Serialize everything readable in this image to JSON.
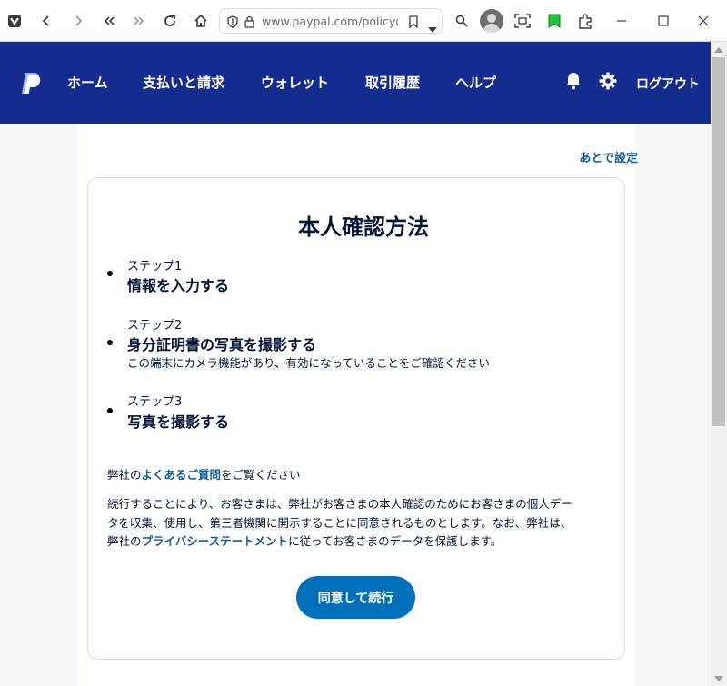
{
  "browser": {
    "url": "www.paypal.com/policydas",
    "colors": {
      "bookmark_green": "#1ec83c"
    }
  },
  "nav": {
    "items": [
      "ホーム",
      "支払いと請求",
      "ウォレット",
      "取引履歴",
      "ヘルプ"
    ],
    "logout": "ログアウト",
    "colors": {
      "background": "#142c8e"
    }
  },
  "page": {
    "set_later": "あとで設定",
    "title": "本人確認方法",
    "steps": [
      {
        "label": "ステップ1",
        "title": "情報を入力する",
        "note": ""
      },
      {
        "label": "ステップ2",
        "title": "身分証明書の写真を撮影する",
        "note": "この端末にカメラ機能があり、有効になっていることをご確認ください"
      },
      {
        "label": "ステップ3",
        "title": "写真を撮影する",
        "note": ""
      }
    ],
    "faq": {
      "prefix": "弊社の",
      "link": "よくあるご質問",
      "suffix": "をご覧ください"
    },
    "consent": {
      "line1": "続行することにより、お客さまは、弊社がお客さまの本人確認のためにお客さまの個人デー",
      "line2": "タを収集、使用し、第三者機関に開示することに同意されるものとします。なお、弊社は、",
      "line3_prefix": "弊社の",
      "line3_link": "プライバシーステートメント",
      "line3_suffix": "に従ってお客さまのデータを保護します。"
    },
    "continue_button": "同意して続行",
    "colors": {
      "link": "#0d5c9e",
      "button": "#0070ba",
      "text": "#001435"
    }
  }
}
